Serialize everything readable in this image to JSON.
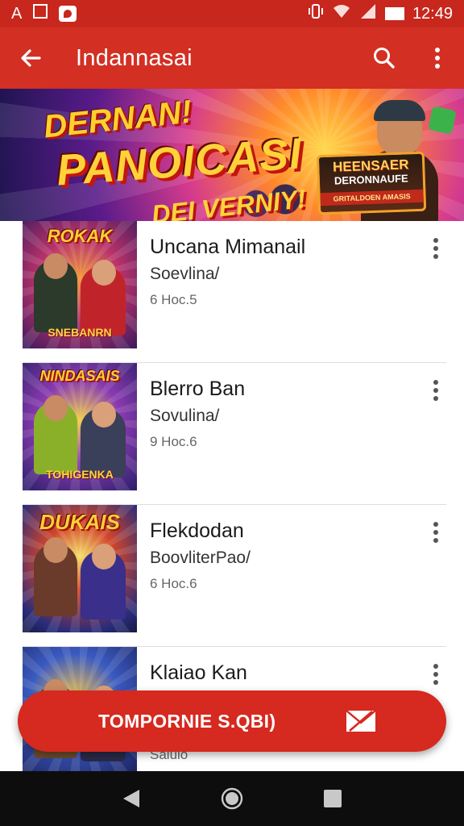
{
  "status_bar": {
    "left_text": "A",
    "time": "12:49",
    "icons": [
      "notification-icon",
      "vibrate-icon",
      "wifi-icon",
      "signal-icon",
      "battery-icon"
    ]
  },
  "app_bar": {
    "title": "Indannasai",
    "icons": [
      "back-arrow-icon",
      "search-icon",
      "overflow-menu-icon"
    ]
  },
  "banner": {
    "line1": "DERNAN!",
    "line2": "PANOICASI",
    "line3": "DEI VERNIY!",
    "badge_line1": "HEENSAER",
    "badge_line2": "DERONNAUFE",
    "badge_line3": "GRITALDOEN AMASIS"
  },
  "list": {
    "items": [
      {
        "thumb_title": "ROKAK",
        "thumb_subtitle": "SNEBANRN",
        "title": "Uncana Mimanail",
        "subtitle": "Soevlina/",
        "meta": "6 Hoc.5",
        "colors": {
          "bg": "#5a2f7a",
          "accent": "#e0462a"
        }
      },
      {
        "thumb_title": "NINDASAIS",
        "thumb_subtitle": "TOHIGENKA",
        "title": "Blerro Ban",
        "subtitle": "Sovulina/",
        "meta": "9 Hoc.6",
        "colors": {
          "bg": "#3a3f9a",
          "accent": "#e6b23a"
        }
      },
      {
        "thumb_title": "DUKAIS",
        "thumb_subtitle": "",
        "title": "Flekdodan",
        "subtitle": "BoovliterPao/",
        "meta": "6 Hoc.6",
        "colors": {
          "bg": "#2a2f7a",
          "accent": "#e84a2a"
        }
      },
      {
        "thumb_title": "",
        "thumb_subtitle": "",
        "title": "Klaiao Kan",
        "subtitle": "",
        "meta": "Salulo",
        "colors": {
          "bg": "#223a8a",
          "accent": "#f0a23a"
        }
      }
    ]
  },
  "fab_bar": {
    "label": "TOMPORNIE S.QBI)",
    "icon": "mail-cancel-icon"
  },
  "nav_bar": {
    "icons": [
      "nav-back-icon",
      "nav-home-icon",
      "nav-recents-icon"
    ]
  },
  "colors": {
    "primary": "#d32f23",
    "status_bar": "#c8271d",
    "fab": "#d6291f",
    "nav": "#0d0d0d"
  }
}
